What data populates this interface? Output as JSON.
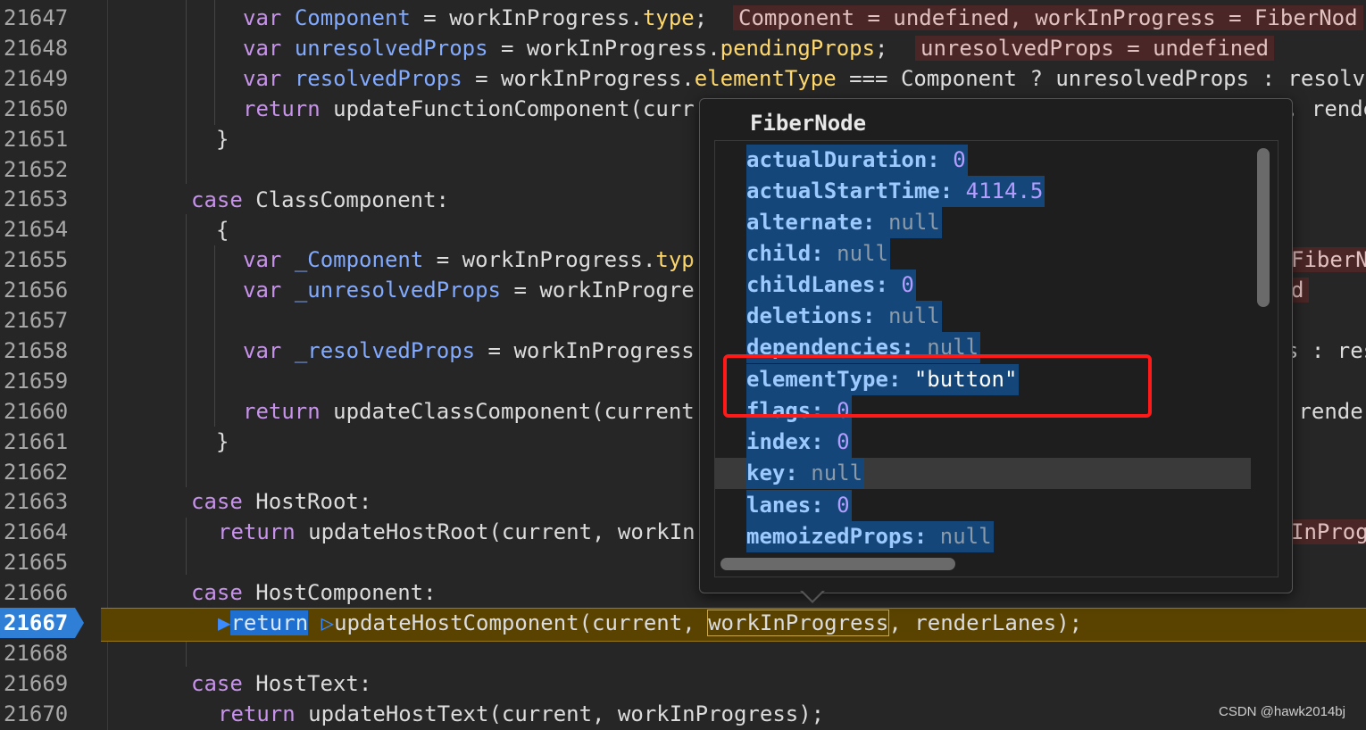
{
  "line_numbers": [
    "21647",
    "21648",
    "21649",
    "21650",
    "21651",
    "21652",
    "21653",
    "21654",
    "21655",
    "21656",
    "21657",
    "21658",
    "21659",
    "21660",
    "21661",
    "21662",
    "21663",
    "21664",
    "21665",
    "21666",
    "21667",
    "21668",
    "21669",
    "21670"
  ],
  "active_line": "21667",
  "code": {
    "l21647": {
      "kw": "var",
      "name": "Component",
      "eq": " = workInProgress.",
      "prop": "type",
      "end": ";",
      "inline": "Component = undefined, workInProgress = FiberNod"
    },
    "l21648": {
      "kw": "var",
      "name": "unresolvedProps",
      "eq": " = workInProgress.",
      "prop": "pendingProps",
      "end": ";",
      "inline": "unresolvedProps = undefined"
    },
    "l21649": {
      "kw": "var",
      "name": "resolvedProps",
      "eq": " = workInProgress.",
      "prop": "elementType",
      "rest": " === Component ? unresolvedProps : resolv"
    },
    "l21650": {
      "kw": "return",
      "rest": " updateFunctionComponent(curr",
      "tail": ", rende"
    },
    "l21651": {
      "text": "}"
    },
    "l21653": {
      "kw": "case",
      "rest": " ClassComponent:"
    },
    "l21654": {
      "text": "{"
    },
    "l21655": {
      "kw": "var",
      "name": "_Component",
      "eq": " = workInProgress.",
      "prop": "typ",
      "inline": "FiberN"
    },
    "l21656": {
      "kw": "var",
      "name": "_unresolvedProps",
      "eq": " = workInProgre",
      "inline": "d"
    },
    "l21658": {
      "kw": "var",
      "name": "_resolvedProps",
      "eq": " = workInProgress",
      "tail": "s : res"
    },
    "l21660": {
      "kw": "return",
      "rest": " updateClassComponent(current",
      "tail": " render"
    },
    "l21661": {
      "text": "}"
    },
    "l21663": {
      "kw": "case",
      "rest": " HostRoot:"
    },
    "l21664": {
      "kw": "return",
      "rest": " updateHostRoot(current, workIn",
      "inline": "InProg"
    },
    "l21666": {
      "kw": "case",
      "rest": " HostComponent:"
    },
    "l21667": {
      "kw": "return",
      "fn": "updateHostComponent(current, ",
      "boxed": "workInProgress",
      "rest": ", renderLanes);"
    },
    "l21669": {
      "kw": "case",
      "rest": " HostText:"
    },
    "l21670": {
      "kw": "return",
      "rest": " updateHostText(current, workInProgress);"
    }
  },
  "popup": {
    "title": "FiberNode",
    "properties": [
      {
        "key": "actualDuration",
        "sep": ": ",
        "value": "0",
        "kind": "num"
      },
      {
        "key": "actualStartTime",
        "sep": ": ",
        "value": "4114.5",
        "kind": "num"
      },
      {
        "key": "alternate",
        "sep": ": ",
        "value": "null",
        "kind": "null"
      },
      {
        "key": "child",
        "sep": ": ",
        "value": "null",
        "kind": "null"
      },
      {
        "key": "childLanes",
        "sep": ": ",
        "value": "0",
        "kind": "num"
      },
      {
        "key": "deletions",
        "sep": ": ",
        "value": "null",
        "kind": "null"
      },
      {
        "key": "dependencies",
        "sep": ": ",
        "value": "null",
        "kind": "null"
      },
      {
        "key": "elementType",
        "sep": ": ",
        "value": "\"button\"",
        "kind": "str"
      },
      {
        "key": "flags",
        "sep": ": ",
        "value": "0",
        "kind": "num"
      },
      {
        "key": "index",
        "sep": ": ",
        "value": "0",
        "kind": "num"
      },
      {
        "key": "key",
        "sep": ": ",
        "value": "null",
        "kind": "null"
      },
      {
        "key": "lanes",
        "sep": ": ",
        "value": "0",
        "kind": "num"
      },
      {
        "key": "memoizedProps",
        "sep": ": ",
        "value": "null",
        "kind": "null"
      }
    ]
  },
  "watermark": "CSDN @hawk2014bj",
  "colors": {
    "background": "#262626",
    "keyword": "#c792ea",
    "identifier": "#82aaff",
    "property": "#ffd86b",
    "exec_line": "#5a4300",
    "highlight_box": "#ff1a1a"
  }
}
